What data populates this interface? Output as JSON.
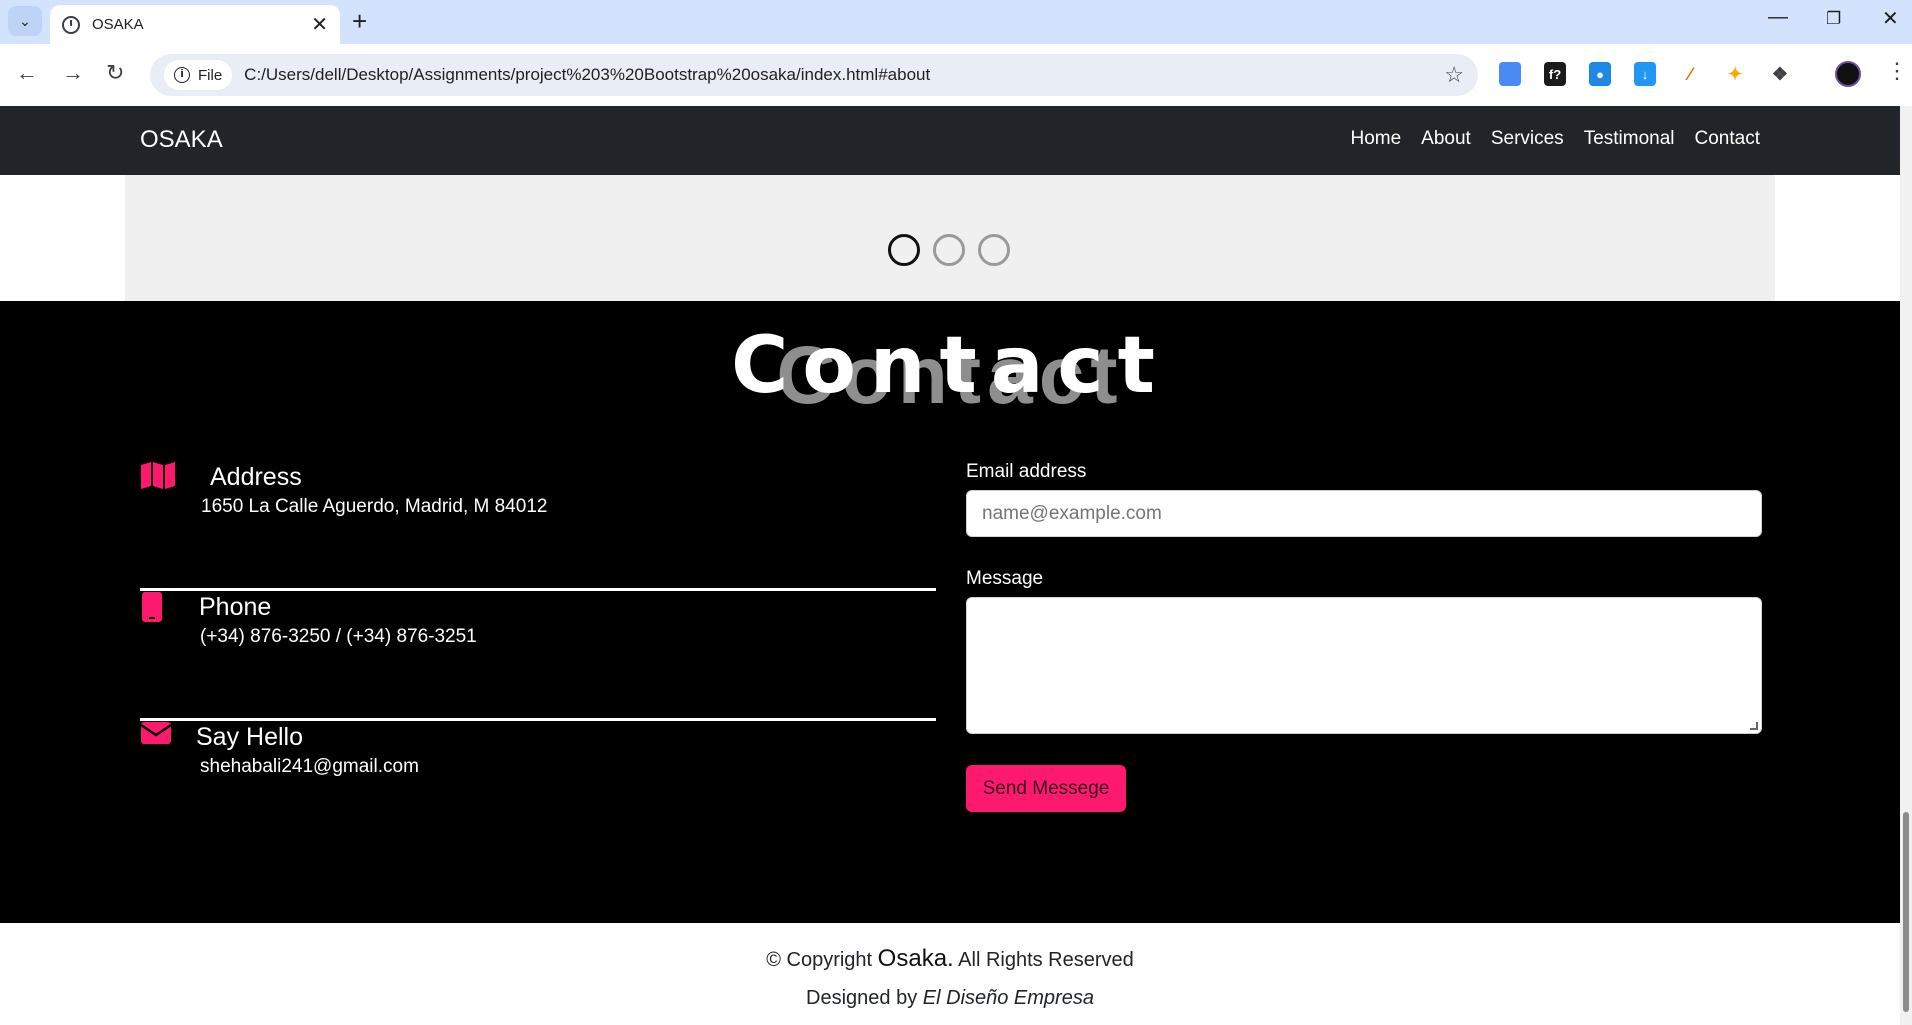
{
  "browser": {
    "tab_title": "OSAKA",
    "site_chip_label": "File",
    "url": "C:/Users/dell/Desktop/Assignments/project%203%20Bootstrap%20osaka/index.html#about"
  },
  "navbar": {
    "brand": "OSAKA",
    "links": [
      "Home",
      "About",
      "Services",
      "Testimonal",
      "Contact"
    ]
  },
  "contact": {
    "heading": "Contact",
    "heading_shadow": "Contact",
    "items": [
      {
        "icon": "map-icon",
        "title": "Address",
        "text": "1650 La Calle Aguerdo, Madrid, M 84012"
      },
      {
        "icon": "phone-icon",
        "title": "Phone",
        "text": "(+34) 876-3250 / (+34) 876-3251"
      },
      {
        "icon": "envelope-icon",
        "title": "Say Hello",
        "text": "shehabali241@gmail.com"
      }
    ],
    "form": {
      "email_label": "Email address",
      "email_placeholder": "name@example.com",
      "message_label": "Message",
      "send_label": "Send Messege"
    }
  },
  "footer": {
    "copyright_prefix": "© Copyright ",
    "brand": "Osaka.",
    "copyright_suffix": " All Rights Reserved",
    "designed_prefix": "Designed by ",
    "designer": "El Diseño Empresa"
  },
  "colors": {
    "accent": "#fd1a6e",
    "navbar_bg": "#212529",
    "contact_bg": "#000000"
  }
}
